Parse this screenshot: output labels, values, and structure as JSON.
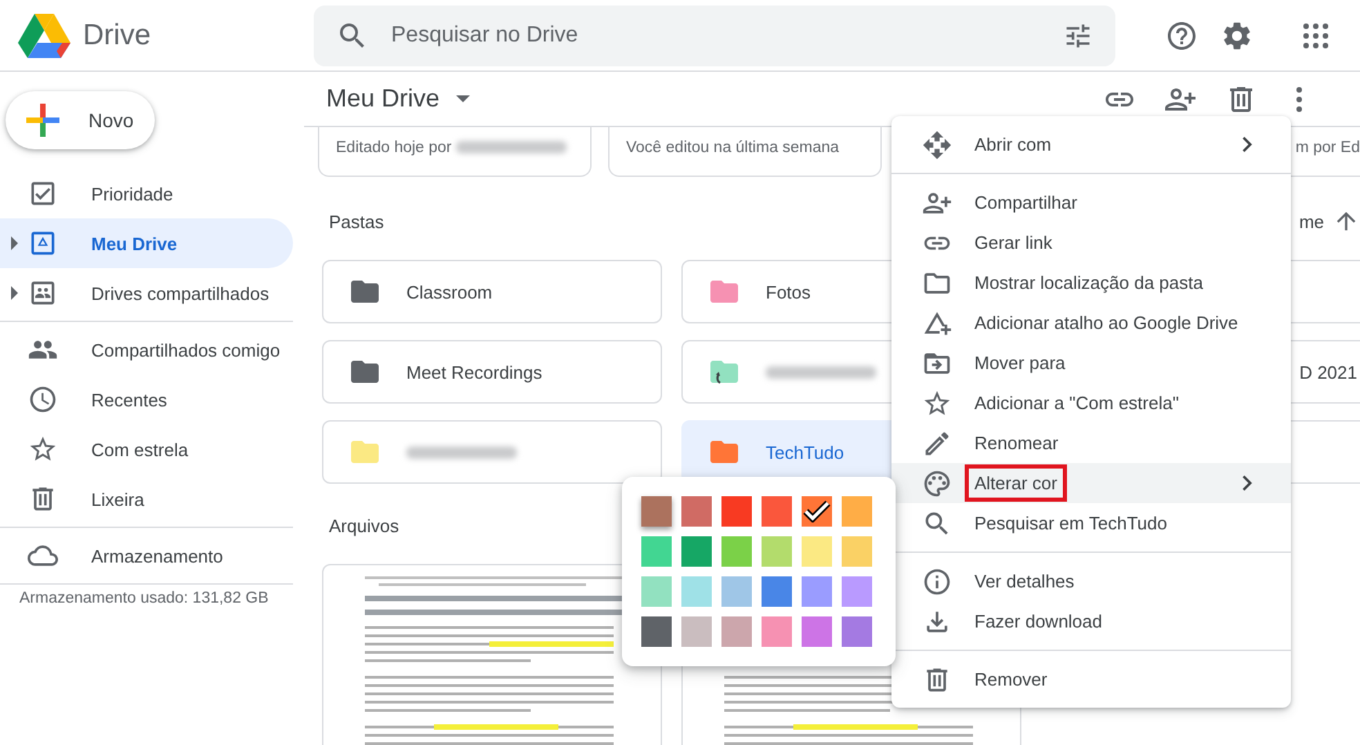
{
  "header": {
    "app_name": "Drive",
    "search": {
      "placeholder": "Pesquisar no Drive"
    }
  },
  "sidebar": {
    "new_button": "Novo",
    "sections": [
      [
        {
          "label": "Prioridade",
          "selected": false,
          "expandable": false
        },
        {
          "label": "Meu Drive",
          "selected": true,
          "expandable": true
        },
        {
          "label": "Drives compartilhados",
          "selected": false,
          "expandable": true
        }
      ],
      [
        {
          "label": "Compartilhados comigo",
          "selected": false,
          "expandable": false
        },
        {
          "label": "Recentes",
          "selected": false,
          "expandable": false
        },
        {
          "label": "Com estrela",
          "selected": false,
          "expandable": false
        },
        {
          "label": "Lixeira",
          "selected": false,
          "expandable": false
        }
      ],
      [
        {
          "label": "Armazenamento",
          "selected": false,
          "expandable": false
        }
      ]
    ],
    "storage_used": "Armazenamento usado: 131,82 GB"
  },
  "toolbar": {
    "title": "Meu Drive"
  },
  "suggested": [
    {
      "subtitle": "Editado hoje por",
      "redacted": true
    },
    {
      "subtitle": "Você editou na última semana",
      "redacted": false
    },
    {
      "subtitle": "m por Ed",
      "redacted": false
    }
  ],
  "folders_heading": "Pastas",
  "sort_label": "me",
  "folders": [
    {
      "name": "Classroom",
      "color": "#5f6368",
      "selected": false,
      "shortcut": false,
      "redacted": false
    },
    {
      "name": "Fotos",
      "color": "#f691b2",
      "selected": false,
      "shortcut": false,
      "redacted": false
    },
    {
      "selected": false
    },
    {
      "name": "Meet Recordings",
      "color": "#5f6368",
      "selected": false,
      "shortcut": false,
      "redacted": false
    },
    {
      "color": "#92e1c0",
      "selected": false,
      "shortcut": true,
      "redacted": true
    },
    {
      "name": "D 2021",
      "selected": false
    },
    {
      "color": "#fbe983",
      "selected": false,
      "shortcut": false,
      "redacted": true
    },
    {
      "name": "TechTudo",
      "color": "#ff7537",
      "selected": true,
      "shortcut": false,
      "redacted": false
    },
    {
      "selected": false
    }
  ],
  "files_heading": "Arquivos",
  "files": [
    {
      "kind": "document"
    },
    {
      "kind": "document"
    }
  ],
  "context_menu": {
    "sections": [
      [
        {
          "label": "Abrir com",
          "submenu": true,
          "highlighted": false,
          "annotated": false
        }
      ],
      [
        {
          "label": "Compartilhar",
          "submenu": false,
          "highlighted": false,
          "annotated": false
        },
        {
          "label": "Gerar link",
          "submenu": false,
          "highlighted": false,
          "annotated": false
        },
        {
          "label": "Mostrar localização da pasta",
          "submenu": false,
          "highlighted": false,
          "annotated": false
        },
        {
          "label": "Adicionar atalho ao Google Drive",
          "submenu": false,
          "highlighted": false,
          "annotated": false
        },
        {
          "label": "Mover para",
          "submenu": false,
          "highlighted": false,
          "annotated": false
        },
        {
          "label": "Adicionar a \"Com estrela\"",
          "submenu": false,
          "highlighted": false,
          "annotated": false
        },
        {
          "label": "Renomear",
          "submenu": false,
          "highlighted": false,
          "annotated": false
        },
        {
          "label": "Alterar cor",
          "submenu": true,
          "highlighted": true,
          "annotated": true
        },
        {
          "label": "Pesquisar em TechTudo",
          "submenu": false,
          "highlighted": false,
          "annotated": false
        }
      ],
      [
        {
          "label": "Ver detalhes",
          "submenu": false,
          "highlighted": false,
          "annotated": false
        },
        {
          "label": "Fazer download",
          "submenu": false,
          "highlighted": false,
          "annotated": false
        }
      ],
      [
        {
          "label": "Remover",
          "submenu": false,
          "highlighted": false,
          "annotated": false
        }
      ]
    ]
  },
  "color_palette": {
    "swatches": [
      {
        "color": "#ac725e",
        "selected": false,
        "hovered": true
      },
      {
        "color": "#d06b64",
        "selected": false,
        "hovered": false
      },
      {
        "color": "#f83a22",
        "selected": false,
        "hovered": false
      },
      {
        "color": "#fa573c",
        "selected": false,
        "hovered": false
      },
      {
        "color": "#ff7537",
        "selected": true,
        "hovered": false
      },
      {
        "color": "#ffad46",
        "selected": false,
        "hovered": false
      },
      {
        "color": "#42d692",
        "selected": false,
        "hovered": false
      },
      {
        "color": "#16a765",
        "selected": false,
        "hovered": false
      },
      {
        "color": "#7bd148",
        "selected": false,
        "hovered": false
      },
      {
        "color": "#b3dc6c",
        "selected": false,
        "hovered": false
      },
      {
        "color": "#fbe983",
        "selected": false,
        "hovered": false
      },
      {
        "color": "#fad165",
        "selected": false,
        "hovered": false
      },
      {
        "color": "#92e1c0",
        "selected": false,
        "hovered": false
      },
      {
        "color": "#9fe1e7",
        "selected": false,
        "hovered": false
      },
      {
        "color": "#9fc6e7",
        "selected": false,
        "hovered": false
      },
      {
        "color": "#4986e7",
        "selected": false,
        "hovered": false
      },
      {
        "color": "#9a9cff",
        "selected": false,
        "hovered": false
      },
      {
        "color": "#b99aff",
        "selected": false,
        "hovered": false
      },
      {
        "color": "#5f6368",
        "selected": false,
        "hovered": false
      },
      {
        "color": "#cabdbf",
        "selected": false,
        "hovered": false
      },
      {
        "color": "#cca6ac",
        "selected": false,
        "hovered": false
      },
      {
        "color": "#f691b2",
        "selected": false,
        "hovered": false
      },
      {
        "color": "#cd74e6",
        "selected": false,
        "hovered": false
      },
      {
        "color": "#a47ae2",
        "selected": false,
        "hovered": false
      }
    ]
  }
}
